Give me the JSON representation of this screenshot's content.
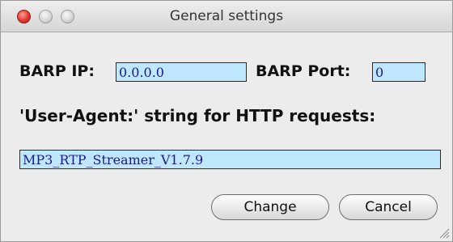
{
  "window": {
    "title": "General settings"
  },
  "form": {
    "barp_ip_label": "BARP IP:",
    "barp_ip_value": "0.0.0.0",
    "barp_port_label": "BARP Port:",
    "barp_port_value": "0",
    "user_agent_label": "'User-Agent:' string for HTTP requests:",
    "user_agent_value": "MP3_RTP_Streamer_V1.7.9"
  },
  "buttons": {
    "change_label": "Change",
    "cancel_label": "Cancel"
  },
  "icons": {
    "close": "close-button-red",
    "minimize": "minimize-button-gray",
    "zoom": "zoom-button-gray",
    "resize": "resize-grip-icon"
  },
  "colors": {
    "field_background": "#bfe7ff",
    "field_text": "#1a1a8c",
    "close_button": "#e0392e"
  }
}
